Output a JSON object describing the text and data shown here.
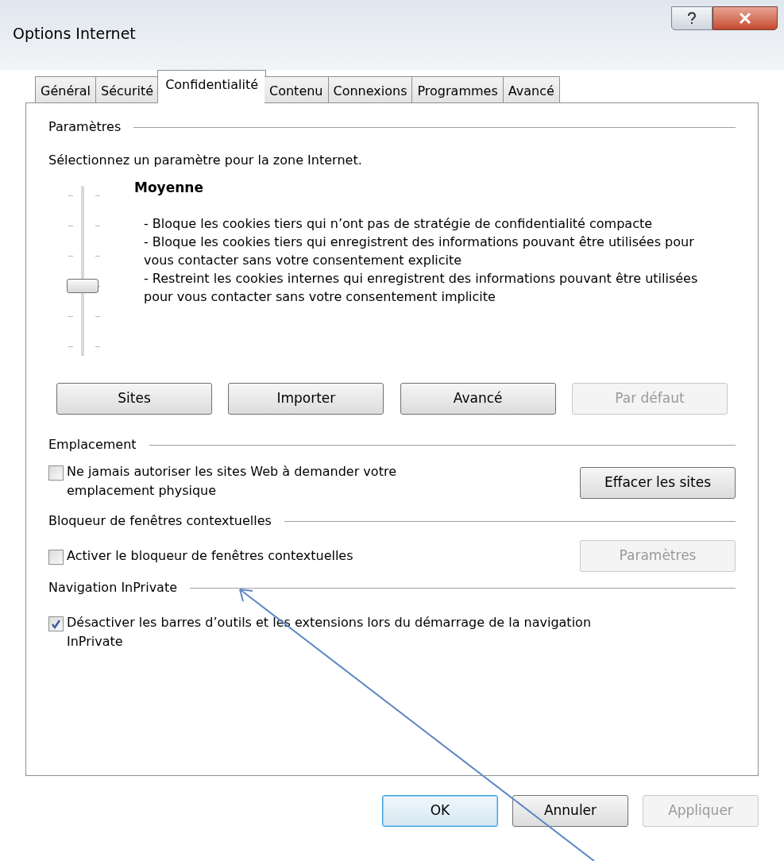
{
  "window": {
    "title": "Options Internet"
  },
  "tabs": [
    {
      "label": "Général",
      "selected": false
    },
    {
      "label": "Sécurité",
      "selected": false
    },
    {
      "label": "Confidentialité",
      "selected": true
    },
    {
      "label": "Contenu",
      "selected": false
    },
    {
      "label": "Connexions",
      "selected": false
    },
    {
      "label": "Programmes",
      "selected": false
    },
    {
      "label": "Avancé",
      "selected": false
    }
  ],
  "settings": {
    "heading": "Paramètres",
    "instruction": "Sélectionnez un paramètre pour la zone Internet.",
    "slider": {
      "level": 0.4
    },
    "level_name": "Moyenne",
    "description": [
      "- Bloque les cookies tiers qui n’ont pas de stratégie de confidentialité compacte",
      "- Bloque les cookies tiers qui enregistrent des informations pouvant être utilisées pour vous contacter sans votre consentement explicite",
      "- Restreint les cookies internes qui enregistrent des informations pouvant être utilisées pour vous contacter sans votre consentement implicite"
    ],
    "buttons": [
      {
        "label": "Sites",
        "disabled": false
      },
      {
        "label": "Importer",
        "disabled": false
      },
      {
        "label": "Avancé",
        "disabled": false
      },
      {
        "label": "Par défaut",
        "disabled": true
      }
    ]
  },
  "location": {
    "heading": "Emplacement",
    "checkbox": {
      "label": "Ne jamais autoriser les sites Web à demander votre emplacement physique",
      "checked": false
    },
    "button": {
      "label": "Effacer les sites",
      "disabled": false
    }
  },
  "popup_blocker": {
    "heading": "Bloqueur de fenêtres contextuelles",
    "checkbox": {
      "label": "Activer le bloqueur de fenêtres contextuelles",
      "checked": false
    },
    "button": {
      "label": "Paramètres",
      "disabled": true
    }
  },
  "inprivate": {
    "heading": "Navigation InPrivate",
    "checkbox": {
      "label": "Désactiver les barres d’outils et les extensions lors du démarrage de la navigation InPrivate",
      "checked": true
    }
  },
  "dialog_buttons": [
    {
      "label": "OK",
      "default": true,
      "disabled": false
    },
    {
      "label": "Annuler",
      "default": false,
      "disabled": false
    },
    {
      "label": "Appliquer",
      "default": false,
      "disabled": true
    }
  ]
}
